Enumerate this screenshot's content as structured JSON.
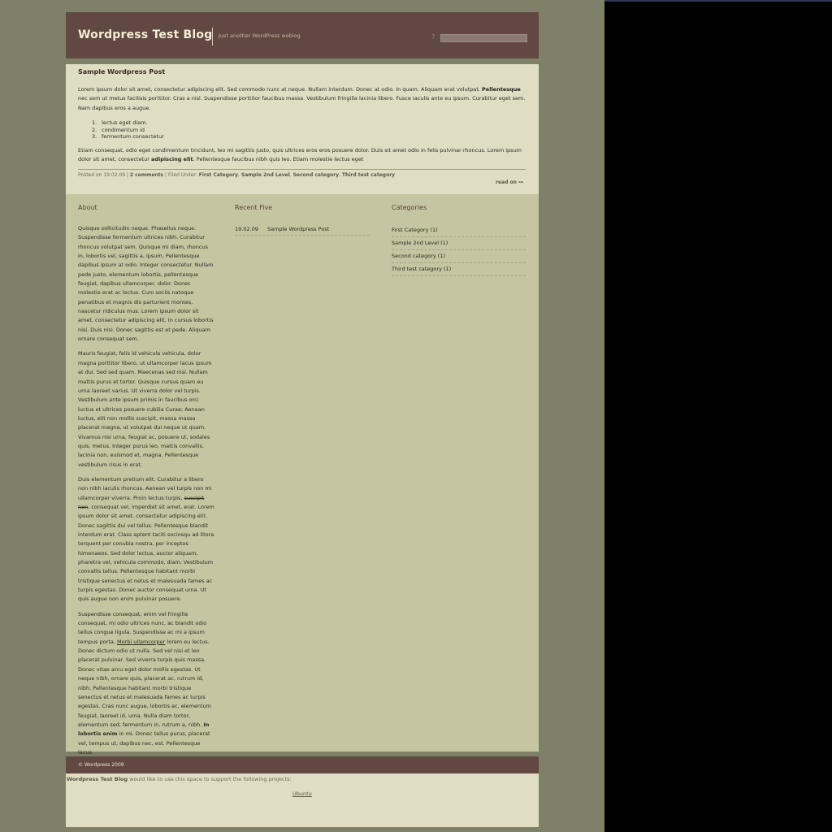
{
  "header": {
    "site_title": "Wordpress Test Blog",
    "tagline": "Just another WordPress weblog",
    "search_icon_glyph": "?",
    "search_value": ""
  },
  "post": {
    "title": "Sample Wordpress Post",
    "p1_text": "Lorem ipsum dolor sit amet, consectetur adipiscing elit. Sed commodo nunc at neque. Nullam interdum. Donec at odio. In quam. Aliquam erat volutpat. ",
    "p1_bold": "Pellentesque",
    "p1_tail": " nec sem ut metus facilisis porttitor. Cras a nisl. Suspendisse porttitor faucibus massa. Vestibulum fringilla lacinia libero. Fusce iaculis ante eu ipsum. Curabitur eget sem. Nam dapibus eros a augue.",
    "list": [
      {
        "num": "1.",
        "text": "lectus eget diam."
      },
      {
        "num": "2.",
        "text": "condimentum id"
      },
      {
        "num": "3.",
        "text": "fermentum consectetur"
      }
    ],
    "p2_text": "Etiam consequat, odio eget condimentum tincidunt, leo mi sagittis justo, quis ultrices eros eros posuere dolor. Duis sit amet odio in felis pulvinar rhoncus. Lorem ipsum dolor sit amet, consectetur ",
    "p2_bold": "adipiscing elit",
    "p2_tail": ". Pellentesque faucibus nibh quis leo. Etiam molestie lectus eget",
    "meta": {
      "posted_on": "Posted on 19.02.09 | ",
      "comments": "2 comments",
      "filed_under": " | Filed Under: ",
      "cats": [
        "First Category",
        "Sample 2nd Level",
        "Second category",
        "Third test category"
      ],
      "sep": ", "
    },
    "read_on": "read on ⊶"
  },
  "about": {
    "title": "About",
    "p1": "Quisque sollicitudin neque. Phasellus neque. Suspendisse fermentum ultrices nibh. Curabitur rhoncus volutpat sem. Quisque mi diam, rhoncus in, lobortis vel, sagittis a, ipsum. Pellentesque dapibus ipsum at odio. Integer consectetur. Nullam pede justo, elementum lobortis, pellentesque feugiat, dapibus ullamcorper, dolor. Donec molestie erat ac lectus. Cum sociis natoque penatibus et magnis dis parturient montes, nascetur ridiculus mus. Lorem ipsum dolor sit amet, consectetur adipiscing elit. In cursus lobortis nisi. Duis nisi. Donec sagittis est et pede. Aliquam ornare consequat sem.",
    "p2": "Mauris feugiat, felis id vehicula vehicula, dolor magna porttitor libero, ut ullamcorper lacus ipsum at dui. Sed sed quam. Maecenas sed nisi. Nullam mattis purus et tortor. Quisque cursus quam eu urna laoreet varius. Ut viverra dolor vel turpis. Vestibulum ante ipsum primis in faucibus orci luctus et ultrices posuere cubilia Curae; Aenean luctus, elit non mollis suscipit, massa massa placerat magna, ut volutpat dui neque ut quam. Vivamus nisi urna, feugiat ac, posuere ut, sodales quis, metus. Integer purus leo, mattis convallis, lacinia non, euismod et, magna. Pellentesque vestibulum risus in erat.",
    "p3_a": "Duis elementum pretium elit. Curabitur a libero non nibh iaculis rhoncus. Aenean vel turpis non mi ullamcorper viverra. Proin lectus turpis, ",
    "p3_strike": "suscipit non",
    "p3_b": ", consequat vel, imperdiet sit amet, erat. Lorem ipsum dolor sit amet, consectetur adipiscing elit. Donec sagittis dui vel tellus. Pellentesque blandit interdum erat. Class aptent taciti sociosqu ad litora torquent per conubia nostra, per inceptos himenaeos. Sed dolor lectus, auctor aliquam, pharetra vel, vehicula commodo, diam. Vestibulum convallis tellus. Pellentesque habitant morbi tristique senectus et netus et malesuada fames ac turpis egestas. Donec auctor consequat urna. Ut quis augue non enim pulvinar posuere.",
    "p4_a": "Suspendisse consequat, enim vel fringilla consequat, mi odio ultrices nunc, ac blandit odio tellus congue ligula. Suspendisse ac mi a ipsum tempus porta. ",
    "p4_link": "Morbi ullamcorper",
    "p4_b": " lorem eu lectus. Donec dictum odio ut nulla. Sed vel nisi et leo placerat pulvinar. Sed viverra turpis quis massa. Donec vitae arcu eget dolor mollis egestas. Ut neque nibh, ornare quis, placerat ac, rutrum id, nibh. Pellentesque habitant morbi tristique senectus et netus et malesuada fames ac turpis egestas. Cras nunc augue, lobortis ac, elementum feugiat, laoreet id, urna. Nulla diam tortor, elementum sed, fermentum in, rutrum a, nibh. ",
    "p4_bold": "In lobortis enim",
    "p4_c": " in mi. Donec tellus purus, placerat vel, tempus ut, dapibus nec, est. Pellentesque lacus."
  },
  "recent": {
    "title": "Recent Five",
    "items": [
      {
        "date": "19.02.09",
        "title": "Sample Wordpress Post"
      }
    ]
  },
  "categories": {
    "title": "Categories",
    "items": [
      "First Category (1)",
      "Sample 2nd Level (1)",
      "Second category (1)",
      "Third test category (1)"
    ]
  },
  "footer": {
    "copyright": "© Wordpress 2009",
    "support_site": "Wordpress Test Blog",
    "support_text": " would like to use this space to support the following projects:",
    "project_link": "Ubuntu"
  }
}
